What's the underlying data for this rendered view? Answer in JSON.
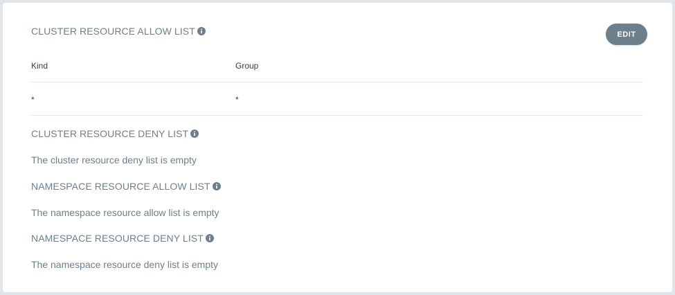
{
  "colors": {
    "accent": "#6d7f8b",
    "background": "#dee6eb",
    "card": "#ffffff",
    "text_dark": "#363c4a"
  },
  "allow_list": {
    "title": "CLUSTER RESOURCE ALLOW LIST",
    "icon": "info-icon",
    "edit_label": "EDIT",
    "columns": [
      "Kind",
      "Group"
    ],
    "rows": [
      [
        "*",
        "*"
      ]
    ]
  },
  "cluster_deny": {
    "title": "CLUSTER RESOURCE DENY LIST",
    "icon": "info-icon",
    "empty": "The cluster resource deny list is empty"
  },
  "namespace_allow": {
    "title": "NAMESPACE RESOURCE ALLOW LIST",
    "icon": "info-icon",
    "empty": "The namespace resource allow list is empty"
  },
  "namespace_deny": {
    "title": "NAMESPACE RESOURCE DENY LIST",
    "icon": "info-icon",
    "empty": "The namespace resource deny list is empty"
  }
}
